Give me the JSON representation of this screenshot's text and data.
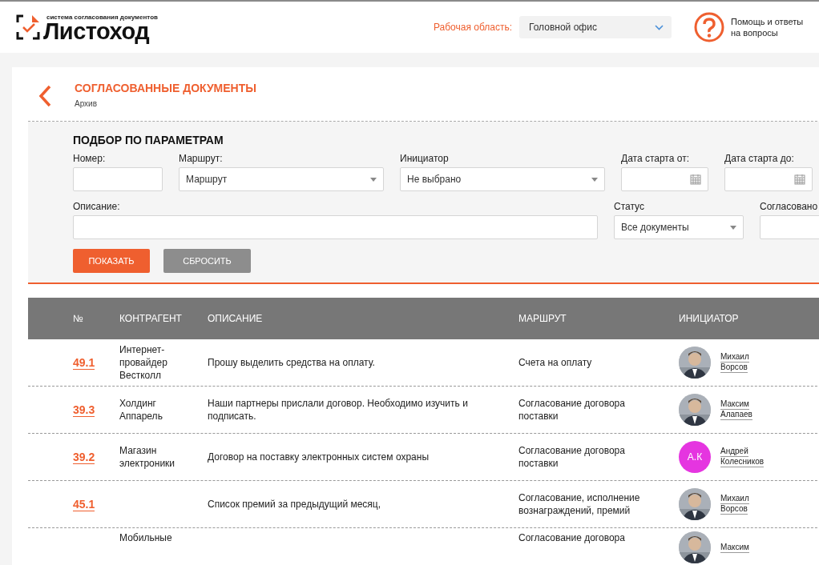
{
  "header": {
    "logo": {
      "tagline": "система согласования документов",
      "name": "Листоход"
    },
    "workspace": {
      "label": "Рабочая область:",
      "value": "Головной офис"
    },
    "help": "Помощь и ответы на вопросы"
  },
  "page": {
    "title": "СОГЛАСОВАННЫЕ ДОКУМЕНТЫ",
    "subtitle": "Архив"
  },
  "filters": {
    "title": "ПОДБОР ПО ПАРАМЕТРАМ",
    "row1": [
      {
        "kind": "text",
        "label": "Номер:"
      },
      {
        "kind": "select",
        "label": "Маршрут:",
        "value": "Маршрут"
      },
      {
        "kind": "select",
        "label": "Инициатор",
        "value": "Не выбрано"
      },
      {
        "kind": "date",
        "label": "Дата старта от:"
      },
      {
        "kind": "date",
        "label": "Дата старта до:"
      }
    ],
    "row2": [
      {
        "kind": "text",
        "label": "Описание:"
      },
      {
        "kind": "select",
        "label": "Статус",
        "value": "Все документы"
      },
      {
        "kind": "text",
        "label": "Согласовано"
      }
    ],
    "buttons": [
      {
        "label": "ПОКАЗАТЬ",
        "kind": "primary"
      },
      {
        "label": "СБРОСИТЬ",
        "kind": "secondary"
      }
    ]
  },
  "table": {
    "columns": [
      "№",
      "КОНТРАГЕНТ",
      "ОПИСАНИЕ",
      "МАРШРУТ",
      "ИНИЦИАТОР"
    ],
    "rows": [
      {
        "number": "49.1",
        "counterparty": "Интернет-провайдер Вестколл",
        "description": "Прошу выделить средства на оплату.",
        "route": "Счета на оплату",
        "initiator": {
          "first": "Михаил",
          "last": "Ворсов"
        }
      },
      {
        "number": "39.3",
        "counterparty": "Холдинг Аппарель",
        "description": "Наши партнеры прислали договор. Необходимо изучить и подписать.",
        "route": "Согласование договора поставки",
        "initiator": {
          "first": "Максим",
          "last": "Алапаев"
        }
      },
      {
        "number": "39.2",
        "counterparty": "Магазин электроники",
        "description": "Договор на поставку электронных систем охраны",
        "route": "Согласование договора поставки",
        "initiator": {
          "first": "Андрей",
          "last": "Колесников",
          "avatar": {
            "kind": "initials",
            "initials": "А.К",
            "color": "#e535e0"
          }
        }
      },
      {
        "number": "45.1",
        "description": "Список премий за предыдущий месяц,",
        "route": "Согласование, исполнение вознаграждений, премий",
        "initiator": {
          "first": "Михаил",
          "last": "Ворсов"
        }
      },
      {
        "counterparty": "Мобильные",
        "route": "Согласование договора",
        "initiator": {
          "first": "Максим"
        }
      }
    ]
  }
}
